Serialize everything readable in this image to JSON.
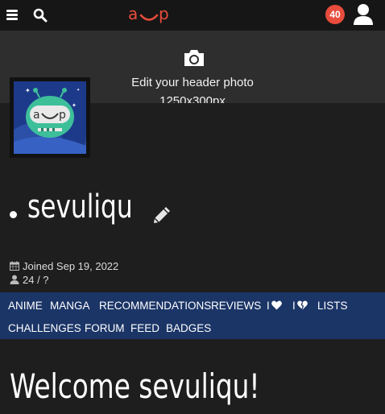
{
  "topbar": {
    "logo_text": "a‿p",
    "notifications_count": "40",
    "icons": [
      "hamburger-menu-icon",
      "search-icon",
      "user-icon"
    ]
  },
  "header_photo": {
    "edit_text": "Edit your header photo",
    "size_text": "1250x300px",
    "icon": "camera-icon"
  },
  "profile": {
    "username": "sevuliqu",
    "joined": "Joined Sep 19, 2022",
    "age_gender": "24 / ?",
    "edit_icon": "pencil-icon"
  },
  "nav": {
    "items": [
      "ANIME",
      "MANGA",
      "RECOMMENDATIONS",
      "REVIEWS",
      "I",
      "I",
      "LISTS",
      "CHALLENGES",
      "FORUM",
      "FEED",
      "BADGES"
    ]
  },
  "welcome": "Welcome sevuliqu!",
  "colors": {
    "brand": "#e74c3c",
    "nav_bg": "#1b3567",
    "avatar_face": "#3dbf9a"
  }
}
